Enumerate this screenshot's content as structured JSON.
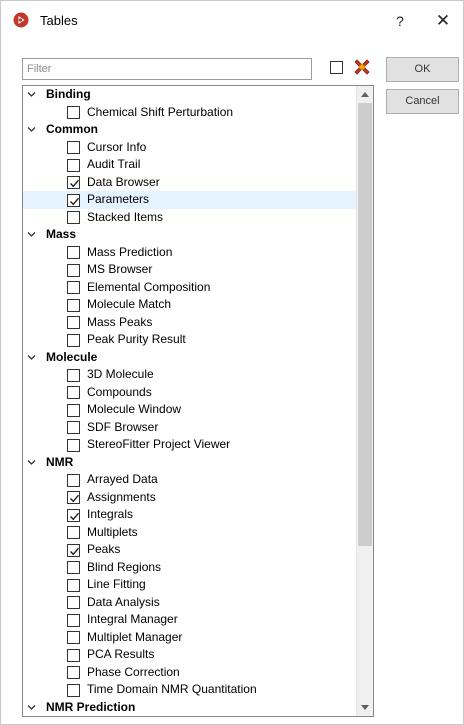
{
  "window": {
    "title": "Tables",
    "help_label": "?",
    "close_label": "✕"
  },
  "filter": {
    "placeholder": "Filter",
    "value": ""
  },
  "buttons": {
    "ok": "OK",
    "cancel": "Cancel"
  },
  "colors": {
    "app_icon": "#c0392b",
    "deselect_icon": "#c0392b",
    "selected_row": "#e5f3ff"
  },
  "tree": [
    {
      "group": "Binding",
      "items": [
        {
          "label": "Chemical Shift Perturbation",
          "checked": false
        }
      ]
    },
    {
      "group": "Common",
      "items": [
        {
          "label": "Cursor Info",
          "checked": false
        },
        {
          "label": "Audit Trail",
          "checked": false
        },
        {
          "label": "Data Browser",
          "checked": true
        },
        {
          "label": "Parameters",
          "checked": true,
          "selected": true
        },
        {
          "label": "Stacked Items",
          "checked": false
        }
      ]
    },
    {
      "group": "Mass",
      "items": [
        {
          "label": "Mass Prediction",
          "checked": false
        },
        {
          "label": "MS Browser",
          "checked": false
        },
        {
          "label": "Elemental Composition",
          "checked": false
        },
        {
          "label": "Molecule Match",
          "checked": false
        },
        {
          "label": "Mass Peaks",
          "checked": false
        },
        {
          "label": "Peak Purity Result",
          "checked": false
        }
      ]
    },
    {
      "group": "Molecule",
      "items": [
        {
          "label": "3D Molecule",
          "checked": false
        },
        {
          "label": "Compounds",
          "checked": false
        },
        {
          "label": "Molecule Window",
          "checked": false
        },
        {
          "label": "SDF Browser",
          "checked": false
        },
        {
          "label": "StereoFitter Project Viewer",
          "checked": false
        }
      ]
    },
    {
      "group": "NMR",
      "items": [
        {
          "label": "Arrayed Data",
          "checked": false
        },
        {
          "label": "Assignments",
          "checked": true
        },
        {
          "label": "Integrals",
          "checked": true
        },
        {
          "label": "Multiplets",
          "checked": false
        },
        {
          "label": "Peaks",
          "checked": true
        },
        {
          "label": "Blind Regions",
          "checked": false
        },
        {
          "label": "Line Fitting",
          "checked": false
        },
        {
          "label": "Data Analysis",
          "checked": false
        },
        {
          "label": "Integral Manager",
          "checked": false
        },
        {
          "label": "Multiplet Manager",
          "checked": false
        },
        {
          "label": "PCA Results",
          "checked": false
        },
        {
          "label": "Phase Correction",
          "checked": false
        },
        {
          "label": "Time Domain NMR Quantitation",
          "checked": false
        }
      ]
    },
    {
      "group": "NMR Prediction",
      "items": []
    }
  ]
}
